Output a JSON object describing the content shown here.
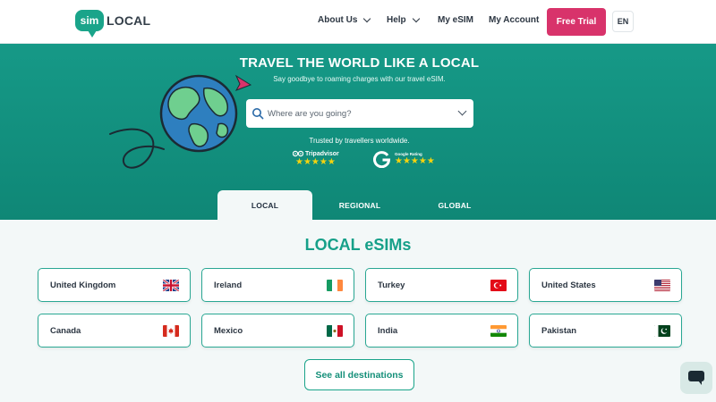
{
  "header": {
    "logo_badge": "sim",
    "logo_word": "LOCAL",
    "nav": {
      "about": "About Us",
      "help": "Help",
      "myesim": "My eSIM",
      "account": "My Account"
    },
    "free_trial": "Free Trial",
    "language": "EN"
  },
  "hero": {
    "title": "TRAVEL THE WORLD LIKE A LOCAL",
    "subtitle": "Say goodbye to roaming charges with our travel eSIM.",
    "search_placeholder": "Where are you going?",
    "trusted": "Trusted by travellers worldwide.",
    "tripadvisor_label": "Tripadvisor",
    "tripadvisor_stars": "★★★★★",
    "google_label": "Google Rating",
    "google_stars": "★★★★★"
  },
  "tabs": [
    {
      "label": "LOCAL",
      "active": true
    },
    {
      "label": "REGIONAL",
      "active": false
    },
    {
      "label": "GLOBAL",
      "active": false
    }
  ],
  "section_title": "LOCAL eSIMs",
  "destinations": [
    {
      "label": "United Kingdom",
      "flag": "gb-flag-icon"
    },
    {
      "label": "Ireland",
      "flag": "ie-flag-icon"
    },
    {
      "label": "Turkey",
      "flag": "tr-flag-icon"
    },
    {
      "label": "United States",
      "flag": "us-flag-icon"
    },
    {
      "label": "Canada",
      "flag": "ca-flag-icon"
    },
    {
      "label": "Mexico",
      "flag": "mx-flag-icon"
    },
    {
      "label": "India",
      "flag": "in-flag-icon"
    },
    {
      "label": "Pakistan",
      "flag": "pk-flag-icon"
    }
  ],
  "see_all": "See all destinations",
  "colors": {
    "brand_teal": "#16a089",
    "cta_pink": "#d8336b",
    "page_bg": "#f3f8f8"
  }
}
